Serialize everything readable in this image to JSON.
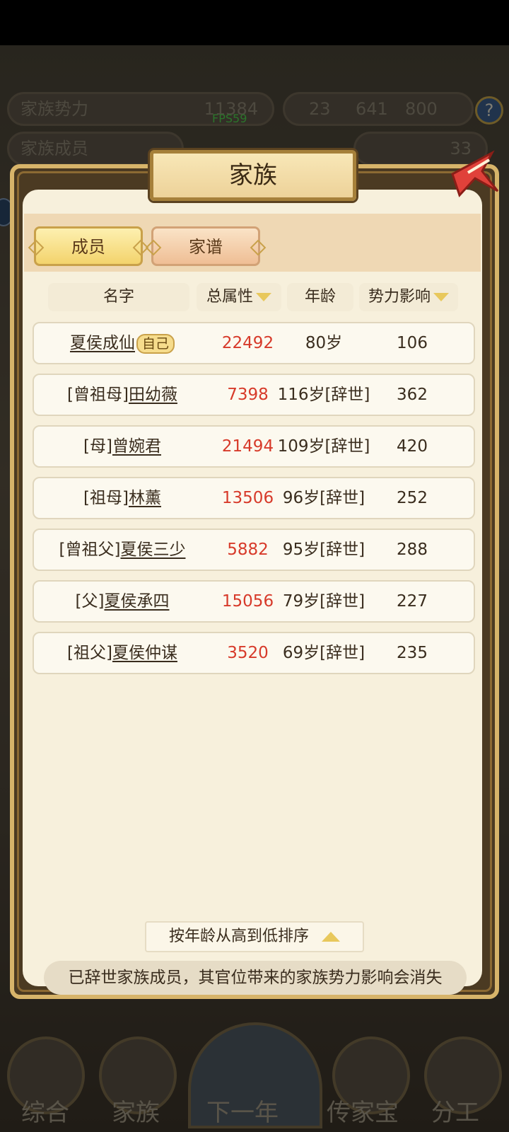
{
  "background_hud": {
    "clan_power_label": "家族势力",
    "clan_power_value": "11384",
    "fps": "FPS59",
    "resource_values": [
      "23",
      "641",
      "800"
    ],
    "clan_members_label": "家族成员",
    "misc_value": "33"
  },
  "modal": {
    "title": "家族",
    "tabs": [
      {
        "label": "成员",
        "selected": true
      },
      {
        "label": "家谱",
        "selected": false
      }
    ],
    "columns": {
      "name": "名字",
      "total_attr": "总属性",
      "age": "年龄",
      "influence": "势力影响"
    },
    "rows": [
      {
        "prefix": "",
        "name": "夏侯成仙",
        "self_tag": "自己",
        "total_attr": "22492",
        "age": "80岁",
        "influence": "106"
      },
      {
        "prefix": "[曾祖母]",
        "name": "田幼薇",
        "self_tag": "",
        "total_attr": "7398",
        "age": "116岁[辞世]",
        "influence": "362"
      },
      {
        "prefix": "[母]",
        "name": "曾婉君",
        "self_tag": "",
        "total_attr": "21494",
        "age": "109岁[辞世]",
        "influence": "420"
      },
      {
        "prefix": "[祖母]",
        "name": "林薰",
        "self_tag": "",
        "total_attr": "13506",
        "age": "96岁[辞世]",
        "influence": "252"
      },
      {
        "prefix": "[曾祖父]",
        "name": "夏侯三少",
        "self_tag": "",
        "total_attr": "5882",
        "age": "95岁[辞世]",
        "influence": "288"
      },
      {
        "prefix": "[父]",
        "name": "夏侯承四",
        "self_tag": "",
        "total_attr": "15056",
        "age": "79岁[辞世]",
        "influence": "227"
      },
      {
        "prefix": "[祖父]",
        "name": "夏侯仲谋",
        "self_tag": "",
        "total_attr": "3520",
        "age": "69岁[辞世]",
        "influence": "235"
      }
    ],
    "sort_button": "按年龄从高到低排序",
    "notice": "已辞世家族成员，其官位带来的家族势力影响会消失"
  },
  "bottom_nav": [
    {
      "label": "综合"
    },
    {
      "label": "家族"
    },
    {
      "label": "下一年"
    },
    {
      "label": "传家宝"
    },
    {
      "label": "分工"
    }
  ],
  "colors": {
    "attr_value": "#d73a2a",
    "panel_bg": "#f7f0dc",
    "frame_gold": "#d7b46a"
  }
}
